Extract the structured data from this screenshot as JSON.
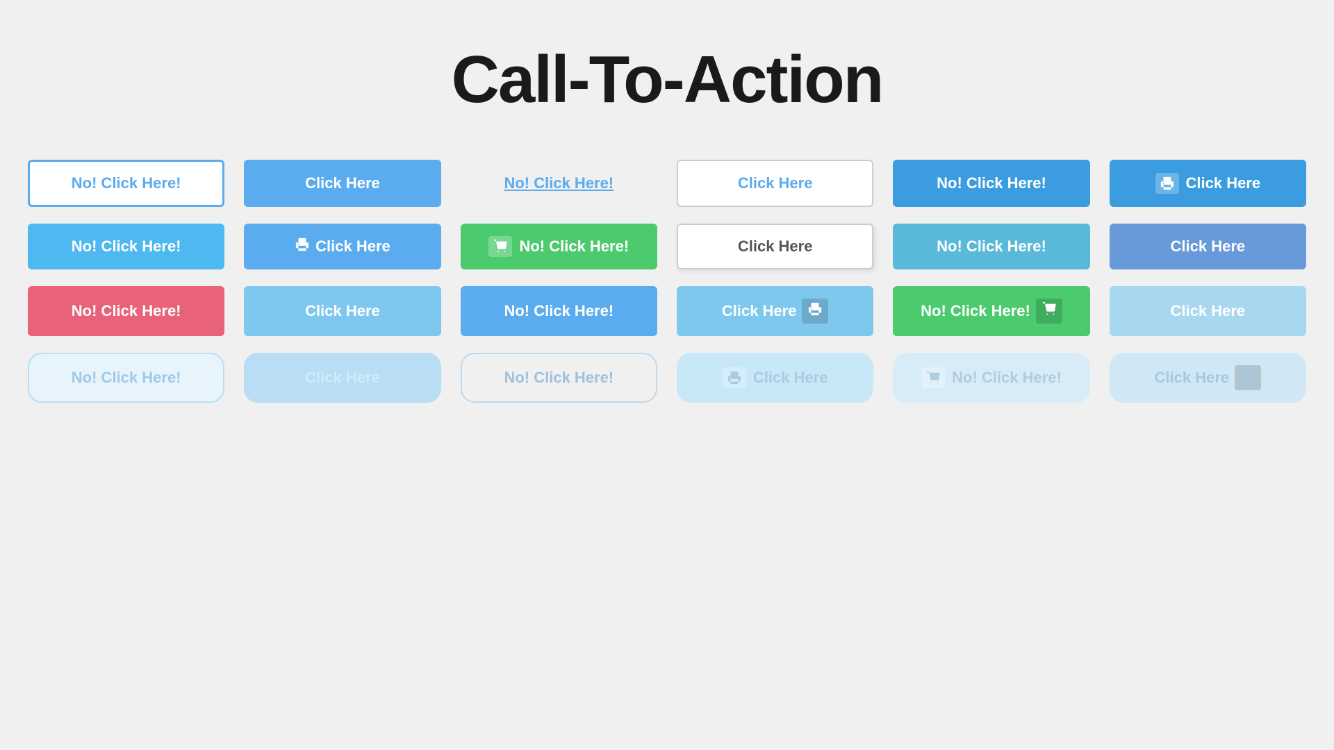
{
  "page": {
    "title": "Call-To-Action"
  },
  "rows": [
    {
      "cells": [
        {
          "id": "r1c1",
          "label": "No! Click Here!",
          "style": "btn-outline-blue",
          "icon": null,
          "icon_pos": null
        },
        {
          "id": "r1c2",
          "label": "Click Here",
          "style": "btn-solid-blue",
          "icon": null,
          "icon_pos": null
        },
        {
          "id": "r1c3",
          "label": "No! Click Here!",
          "style": "btn-link-blue",
          "icon": null,
          "icon_pos": null
        },
        {
          "id": "r1c4",
          "label": "Click Here",
          "style": "btn-outline-gray",
          "icon": null,
          "icon_pos": null
        },
        {
          "id": "r1c5",
          "label": "No! Click Here!",
          "style": "btn-solid-blue-dark",
          "icon": null,
          "icon_pos": null
        },
        {
          "id": "r1c6",
          "label": "Click Here",
          "style": "btn-solid-blue-icon-left",
          "icon": "printer",
          "icon_pos": "left"
        }
      ]
    },
    {
      "cells": [
        {
          "id": "r2c1",
          "label": "No! Click Here!",
          "style": "btn-solid-blue-bright",
          "icon": null,
          "icon_pos": null
        },
        {
          "id": "r2c2",
          "label": "Click Here",
          "style": "btn-solid-blue-print",
          "icon": "printer",
          "icon_pos": "left"
        },
        {
          "id": "r2c3",
          "label": "No! Click Here!",
          "style": "btn-solid-green",
          "icon": "cart",
          "icon_pos": "left"
        },
        {
          "id": "r2c4",
          "label": "Click Here",
          "style": "btn-outlined-gray-shadow",
          "icon": null,
          "icon_pos": null
        },
        {
          "id": "r2c5",
          "label": "No! Click Here!",
          "style": "btn-solid-teal",
          "icon": null,
          "icon_pos": null
        },
        {
          "id": "r2c6",
          "label": "Click Here",
          "style": "btn-solid-cornflower",
          "icon": null,
          "icon_pos": null
        }
      ]
    },
    {
      "cells": [
        {
          "id": "r3c1",
          "label": "No! Click Here!",
          "style": "btn-solid-pink",
          "icon": null,
          "icon_pos": null
        },
        {
          "id": "r3c2",
          "label": "Click Here",
          "style": "btn-solid-blue-light",
          "icon": null,
          "icon_pos": null
        },
        {
          "id": "r3c3",
          "label": "No! Click Here!",
          "style": "btn-solid-blue-med",
          "icon": null,
          "icon_pos": null
        },
        {
          "id": "r3c4",
          "label": "Click Here",
          "style": "btn-solid-blue-print-right",
          "icon": "printer",
          "icon_pos": "right"
        },
        {
          "id": "r3c5",
          "label": "No! Click Here!",
          "style": "btn-solid-green-cart",
          "icon": "cart",
          "icon_pos": "right"
        },
        {
          "id": "r3c6",
          "label": "Click Here",
          "style": "btn-solid-blue-pale",
          "icon": null,
          "icon_pos": null
        }
      ]
    },
    {
      "cells": [
        {
          "id": "r4c1",
          "label": "No! Click Here!",
          "style": "btn-disabled-outline",
          "icon": null,
          "icon_pos": null
        },
        {
          "id": "r4c2",
          "label": "Click Here",
          "style": "btn-disabled-blue",
          "icon": null,
          "icon_pos": null
        },
        {
          "id": "r4c3",
          "label": "No! Click Here!",
          "style": "btn-disabled-outline-round",
          "icon": null,
          "icon_pos": null
        },
        {
          "id": "r4c4",
          "label": "Click Here",
          "style": "btn-disabled-icon",
          "icon": "printer",
          "icon_pos": "left"
        },
        {
          "id": "r4c5",
          "label": "No! Click Here!",
          "style": "btn-disabled-icon-cart",
          "icon": "cart",
          "icon_pos": "left"
        },
        {
          "id": "r4c6",
          "label": "Click Here",
          "style": "btn-disabled-icon-right",
          "icon": "printer",
          "icon_pos": "right"
        }
      ]
    }
  ],
  "icons": {
    "printer": "printer-icon",
    "cart": "cart-icon"
  }
}
